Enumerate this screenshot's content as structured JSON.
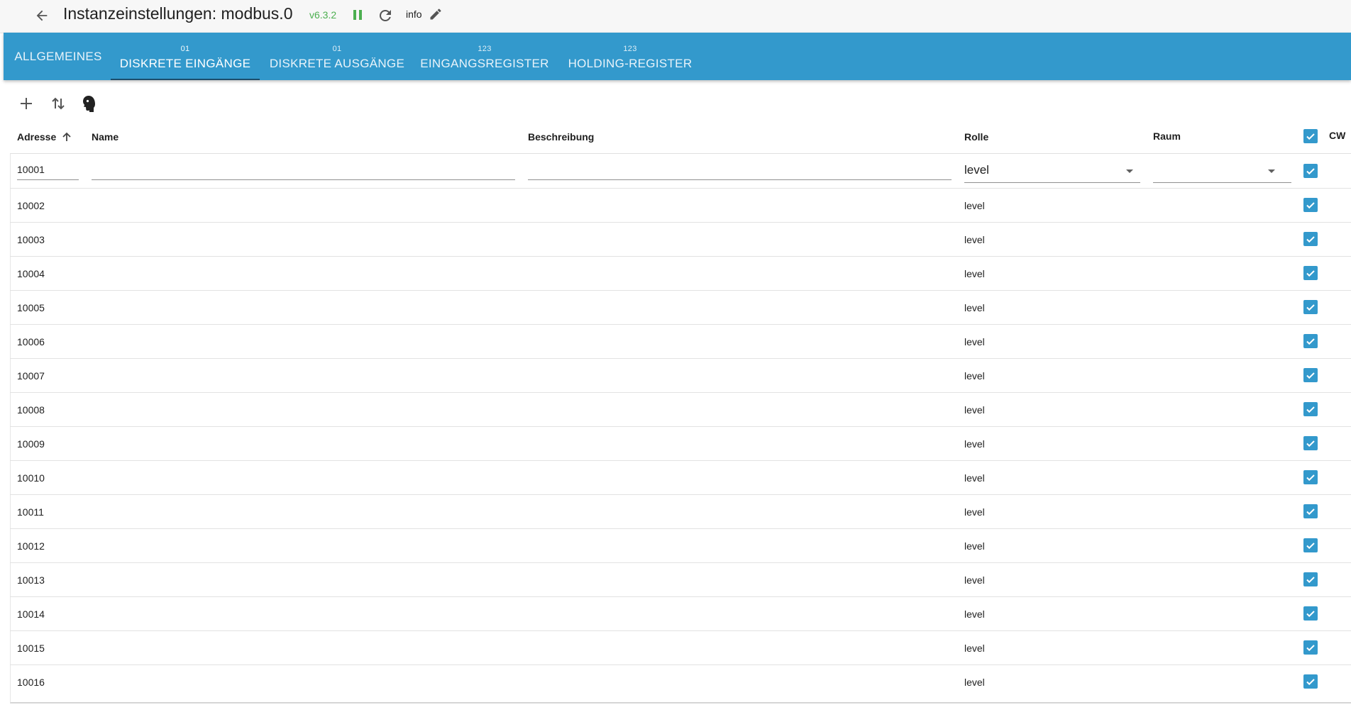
{
  "header": {
    "title": "Instanzeinstellungen: modbus.0",
    "version": "v6.3.2",
    "info_label": "info",
    "back_icon": "arrow-left-icon",
    "pause_icon": "pause-icon",
    "reload_icon": "reload-icon",
    "edit_icon": "pencil-icon"
  },
  "tabs": [
    {
      "caption": "",
      "label": "ALLGEMEINES"
    },
    {
      "caption": "01",
      "label": "DISKRETE EINGÄNGE"
    },
    {
      "caption": "01",
      "label": "DISKRETE AUSGÄNGE"
    },
    {
      "caption": "123",
      "label": "EINGANGSREGISTER"
    },
    {
      "caption": "123",
      "label": "HOLDING-REGISTER"
    }
  ],
  "toolbar": {
    "add_icon": "plus-icon",
    "sort_icon": "sort-arrows-icon",
    "import_icon": "head-silhouette-icon"
  },
  "table": {
    "columns": {
      "address": "Adresse",
      "name": "Name",
      "description": "Beschreibung",
      "role": "Rolle",
      "room": "Raum",
      "cw": "CW"
    },
    "sort_icon": "arrow-up-icon",
    "header_checked": true,
    "edit_row": {
      "address": "10001",
      "name": "",
      "description": "",
      "role": "level",
      "room": "",
      "checked": true
    },
    "rows": [
      {
        "address": "10002",
        "role": "level",
        "checked": true
      },
      {
        "address": "10003",
        "role": "level",
        "checked": true
      },
      {
        "address": "10004",
        "role": "level",
        "checked": true
      },
      {
        "address": "10005",
        "role": "level",
        "checked": true
      },
      {
        "address": "10006",
        "role": "level",
        "checked": true
      },
      {
        "address": "10007",
        "role": "level",
        "checked": true
      },
      {
        "address": "10008",
        "role": "level",
        "checked": true
      },
      {
        "address": "10009",
        "role": "level",
        "checked": true
      },
      {
        "address": "10010",
        "role": "level",
        "checked": true
      },
      {
        "address": "10011",
        "role": "level",
        "checked": true
      },
      {
        "address": "10012",
        "role": "level",
        "checked": true
      },
      {
        "address": "10013",
        "role": "level",
        "checked": true
      },
      {
        "address": "10014",
        "role": "level",
        "checked": true
      },
      {
        "address": "10015",
        "role": "level",
        "checked": true
      },
      {
        "address": "10016",
        "role": "level",
        "checked": true
      }
    ]
  },
  "colors": {
    "accent": "#3399cc",
    "version_green": "#4caf50"
  }
}
